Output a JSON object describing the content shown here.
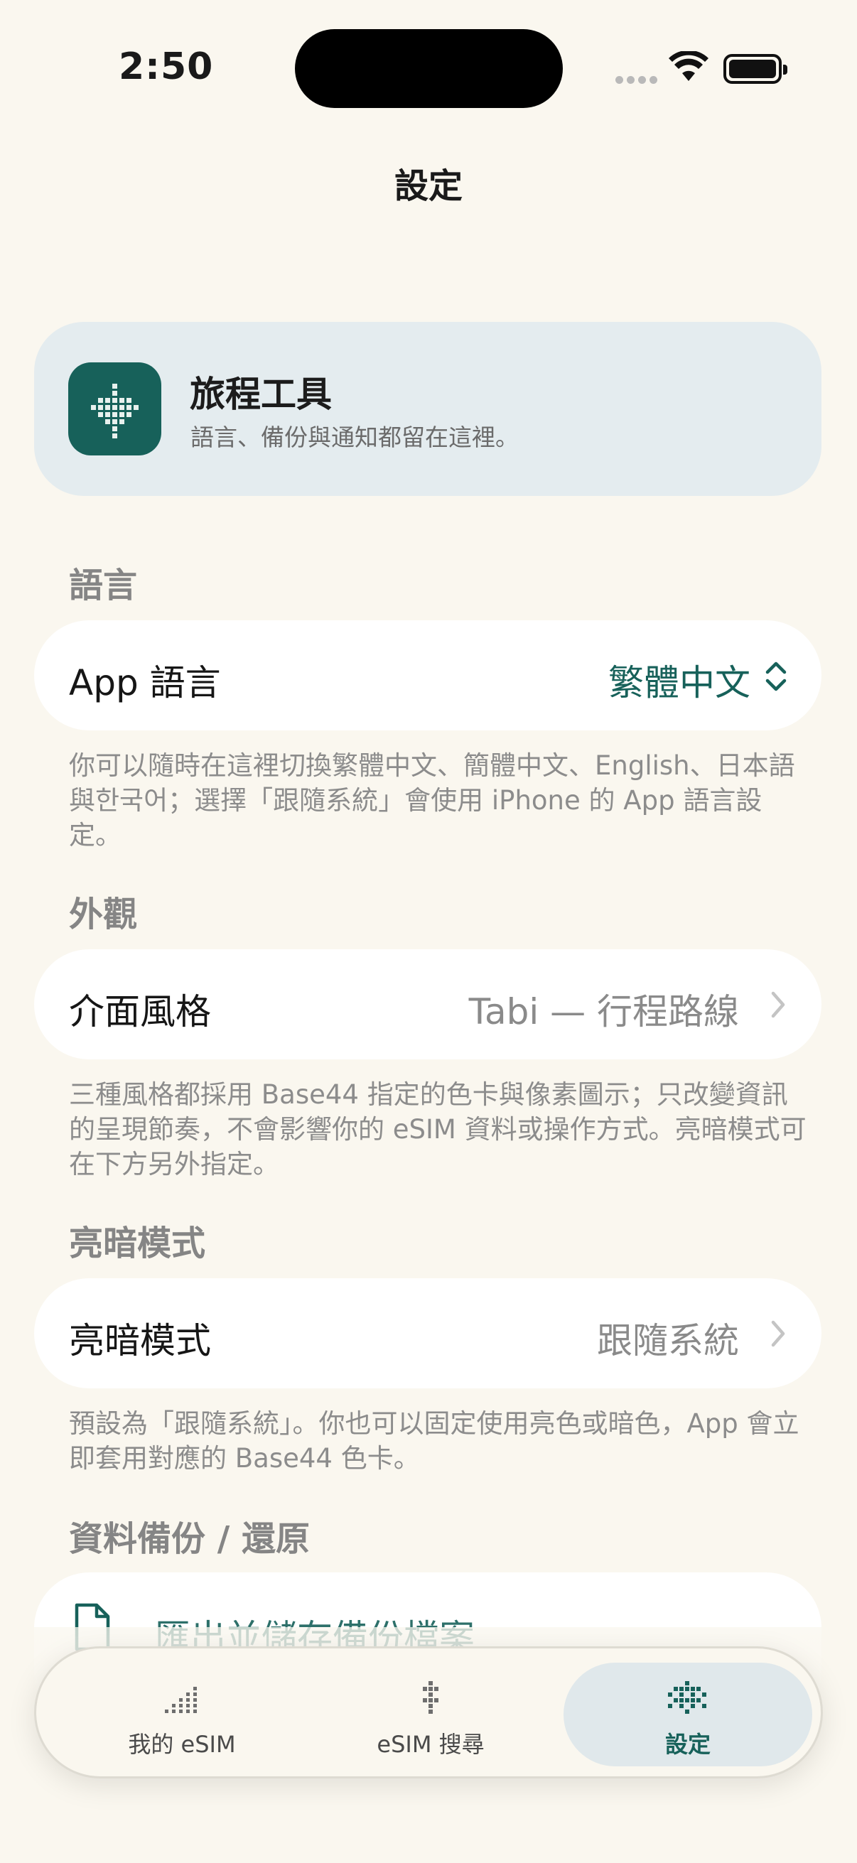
{
  "status_bar": {
    "time": "2:50"
  },
  "nav": {
    "title": "設定"
  },
  "hero": {
    "title": "旅程工具",
    "subtitle": "語言、備份與通知都留在這裡。",
    "icon": "pixel-logo-icon"
  },
  "sections": {
    "language": {
      "header": "語言",
      "row_label": "App 語言",
      "row_value": "繁體中文",
      "footnote": "你可以隨時在這裡切換繁體中文、簡體中文、English、日本語與한국어；選擇「跟隨系統」會使用 iPhone 的 App 語言設定。"
    },
    "appearance": {
      "header": "外觀",
      "row_label": "介面風格",
      "row_value": "Tabi — 行程路線",
      "footnote": "三種風格都採用 Base44 指定的色卡與像素圖示；只改變資訊的呈現節奏，不會影響你的 eSIM 資料或操作方式。亮暗模式可在下方另外指定。"
    },
    "mode": {
      "header": "亮暗模式",
      "row_label": "亮暗模式",
      "row_value": "跟隨系統",
      "footnote": "預設為「跟隨系統」。你也可以固定使用亮色或暗色，App 會立即套用對應的 Base44 色卡。"
    },
    "backup": {
      "header": "資料備份 / 還原",
      "row_label": "匯出並儲存備份檔案"
    }
  },
  "tabs": [
    {
      "label": "我的 eSIM",
      "icon": "signal-bars-icon",
      "active": false
    },
    {
      "label": "eSIM 搜尋",
      "icon": "pixel-search-icon",
      "active": false
    },
    {
      "label": "設定",
      "icon": "pixel-gear-icon",
      "active": true
    }
  ],
  "colors": {
    "background": "#faf7ef",
    "accent": "#17615a",
    "hero_card": "#e4ecef",
    "active_tab": "#e0e8eb"
  }
}
